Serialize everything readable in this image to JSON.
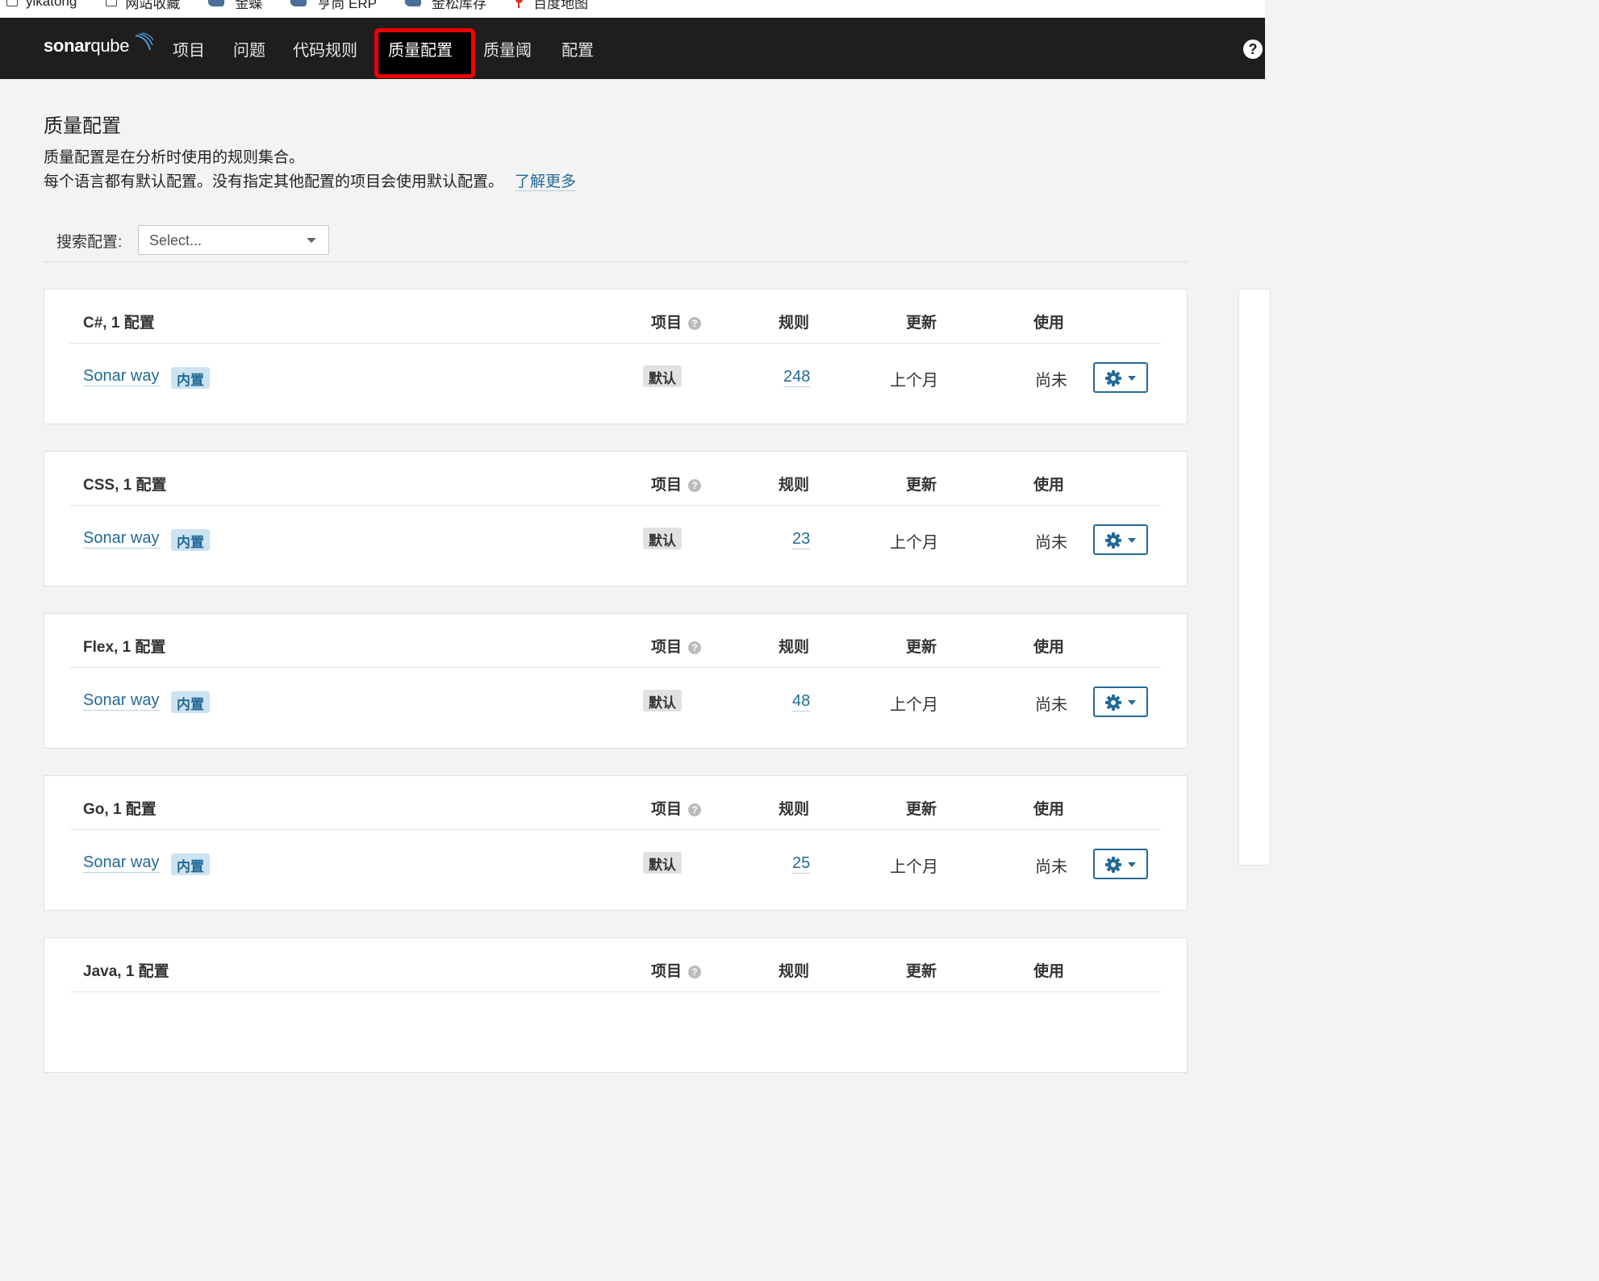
{
  "bookmarks": [
    {
      "label": "yikatong",
      "icon": "folder-icon"
    },
    {
      "label": "网站收藏",
      "icon": "folder-icon"
    },
    {
      "label": "金蝶",
      "icon": "bird-icon"
    },
    {
      "label": "亨尚 ERP",
      "icon": "bird-icon"
    },
    {
      "label": "金松库存",
      "icon": "bird-icon"
    },
    {
      "label": "百度地图",
      "icon": "map-pin-icon"
    }
  ],
  "nav": {
    "logo_text_a": "sonar",
    "logo_text_b": "qube",
    "items": [
      "项目",
      "问题",
      "代码规则",
      "质量配置",
      "质量阈",
      "配置"
    ],
    "active_index": 3,
    "help": "?"
  },
  "page": {
    "title": "质量配置",
    "desc1": "质量配置是在分析时使用的规则集合。",
    "desc2": "每个语言都有默认配置。没有指定其他配置的项目会使用默认配置。",
    "learn_more": "了解更多",
    "search_label": "搜索配置:",
    "search_placeholder": "Select..."
  },
  "columns": {
    "projects": "项目",
    "rules": "规则",
    "updated": "更新",
    "used": "使用"
  },
  "cards": [
    {
      "heading": "C#, 1 配置",
      "profile": "Sonar way",
      "builtin": "内置",
      "default": "默认",
      "rules": "248",
      "updated": "上个月",
      "used": "尚未"
    },
    {
      "heading": "CSS, 1 配置",
      "profile": "Sonar way",
      "builtin": "内置",
      "default": "默认",
      "rules": "23",
      "updated": "上个月",
      "used": "尚未"
    },
    {
      "heading": "Flex, 1 配置",
      "profile": "Sonar way",
      "builtin": "内置",
      "default": "默认",
      "rules": "48",
      "updated": "上个月",
      "used": "尚未"
    },
    {
      "heading": "Go, 1 配置",
      "profile": "Sonar way",
      "builtin": "内置",
      "default": "默认",
      "rules": "25",
      "updated": "上个月",
      "used": "尚未"
    },
    {
      "heading": "Java, 1 配置"
    }
  ]
}
